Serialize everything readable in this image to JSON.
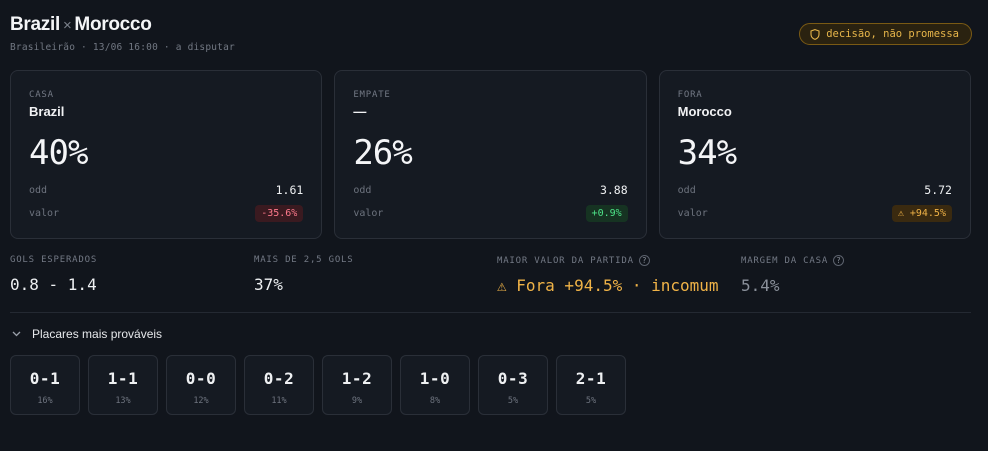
{
  "match": {
    "home": "Brazil",
    "separator": "×",
    "away": "Morocco",
    "subtitle": "Brasileirão · 13/06 16:00 · a disputar",
    "badge": "decisão, não promessa",
    "badge_icon": "shield-icon"
  },
  "cards": [
    {
      "label": "CASA",
      "team": "Brazil",
      "pct": "40%",
      "odd_label": "odd",
      "odd": "1.61",
      "value_label": "valor",
      "value": "-35.6%",
      "tone": "neg"
    },
    {
      "label": "EMPATE",
      "team": "—",
      "pct": "26%",
      "odd_label": "odd",
      "odd": "3.88",
      "value_label": "valor",
      "value": "+0.9%",
      "tone": "pos"
    },
    {
      "label": "FORA",
      "team": "Morocco",
      "pct": "34%",
      "odd_label": "odd",
      "odd": "5.72",
      "value_label": "valor",
      "value": "⚠ +94.5%",
      "tone": "warn"
    }
  ],
  "stats": {
    "goals_label": "GOLS ESPERADOS",
    "goals_value": "0.8 - 1.4",
    "over_label": "MAIS DE 2,5 GOLS",
    "over_value": "37%",
    "best_label": "MAIOR VALOR DA PARTIDA",
    "best_value": "⚠ Fora +94.5% · incomum",
    "margin_label": "MARGEM DA CASA",
    "margin_value": "5.4%",
    "help": "?"
  },
  "scores_section": {
    "title": "Placares mais prováveis",
    "items": [
      {
        "score": "0-1",
        "pct": "16%"
      },
      {
        "score": "1-1",
        "pct": "13%"
      },
      {
        "score": "0-0",
        "pct": "12%"
      },
      {
        "score": "0-2",
        "pct": "11%"
      },
      {
        "score": "1-2",
        "pct": "9%"
      },
      {
        "score": "1-0",
        "pct": "8%"
      },
      {
        "score": "0-3",
        "pct": "5%"
      },
      {
        "score": "2-1",
        "pct": "5%"
      }
    ]
  },
  "colors": {
    "warn": "#f0b347",
    "pos": "#4ee388",
    "neg": "#ff7a8c",
    "bg": "#11151c"
  }
}
